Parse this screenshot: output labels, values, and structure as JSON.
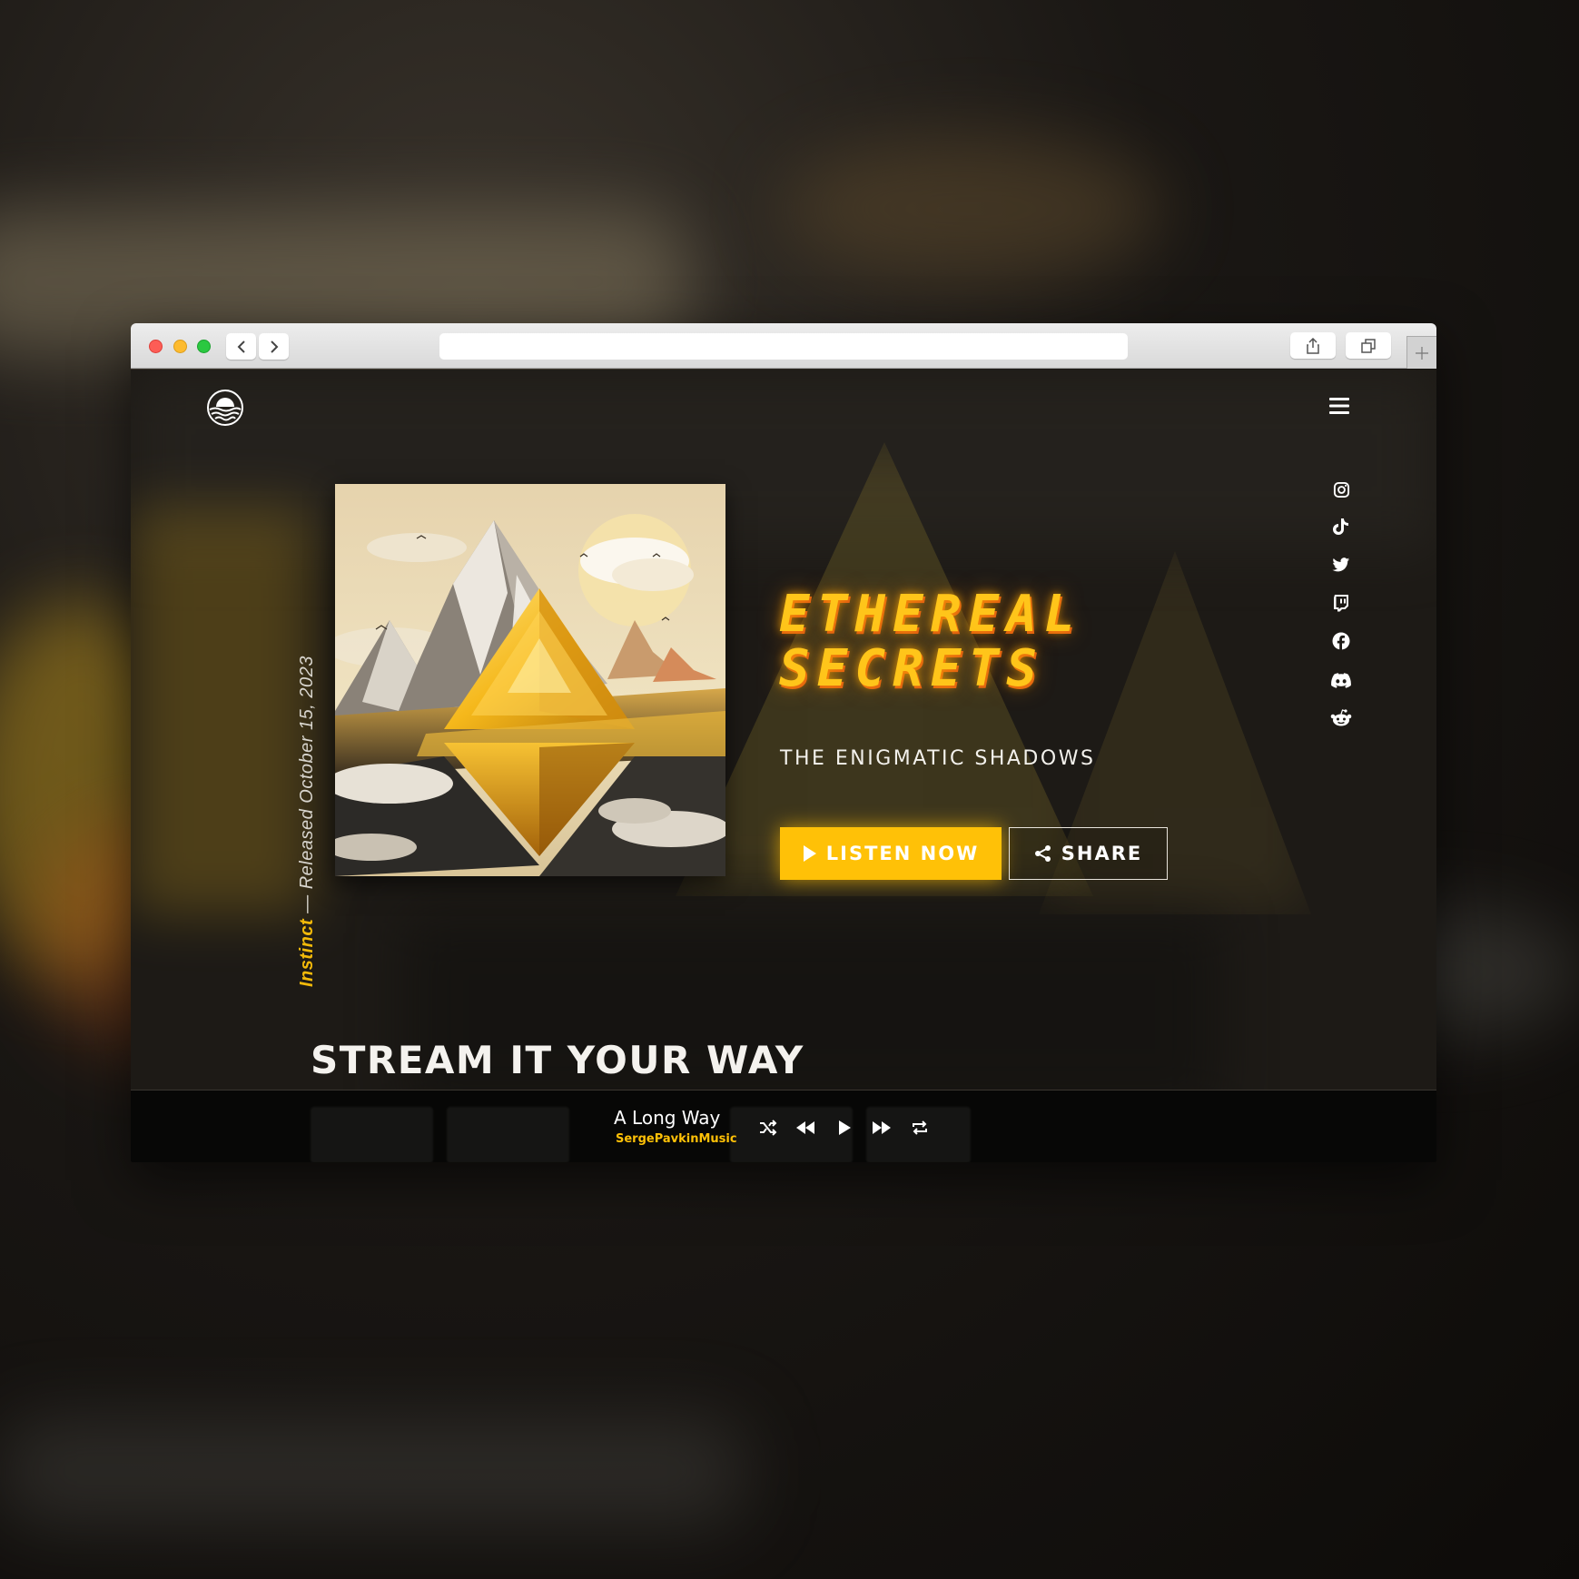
{
  "browser": {
    "back_icon": "chevron-left-icon",
    "forward_icon": "chevron-right-icon",
    "url": ""
  },
  "header": {
    "logo_icon": "sun-over-waves-logo",
    "menu_icon": "hamburger-icon"
  },
  "social": [
    {
      "name": "instagram-icon"
    },
    {
      "name": "tiktok-icon"
    },
    {
      "name": "twitter-icon"
    },
    {
      "name": "twitch-icon"
    },
    {
      "name": "facebook-icon"
    },
    {
      "name": "discord-icon"
    },
    {
      "name": "reddit-icon"
    }
  ],
  "release": {
    "label": "Instinct",
    "released_text": " — Released October 15, 2023"
  },
  "hero": {
    "title_line1": "ETHEREAL",
    "title_line2": "SECRETS",
    "subtitle": "THE ENIGMATIC SHADOWS",
    "listen_label": "LISTEN NOW",
    "share_label": "SHARE"
  },
  "stream": {
    "title": "STREAM IT YOUR WAY"
  },
  "player": {
    "track": "A Long Way",
    "artist": "SergePavkinMusic"
  },
  "colors": {
    "accent": "#ffc107",
    "title_glow": "#ff9a00",
    "background": "#1d1a16"
  }
}
